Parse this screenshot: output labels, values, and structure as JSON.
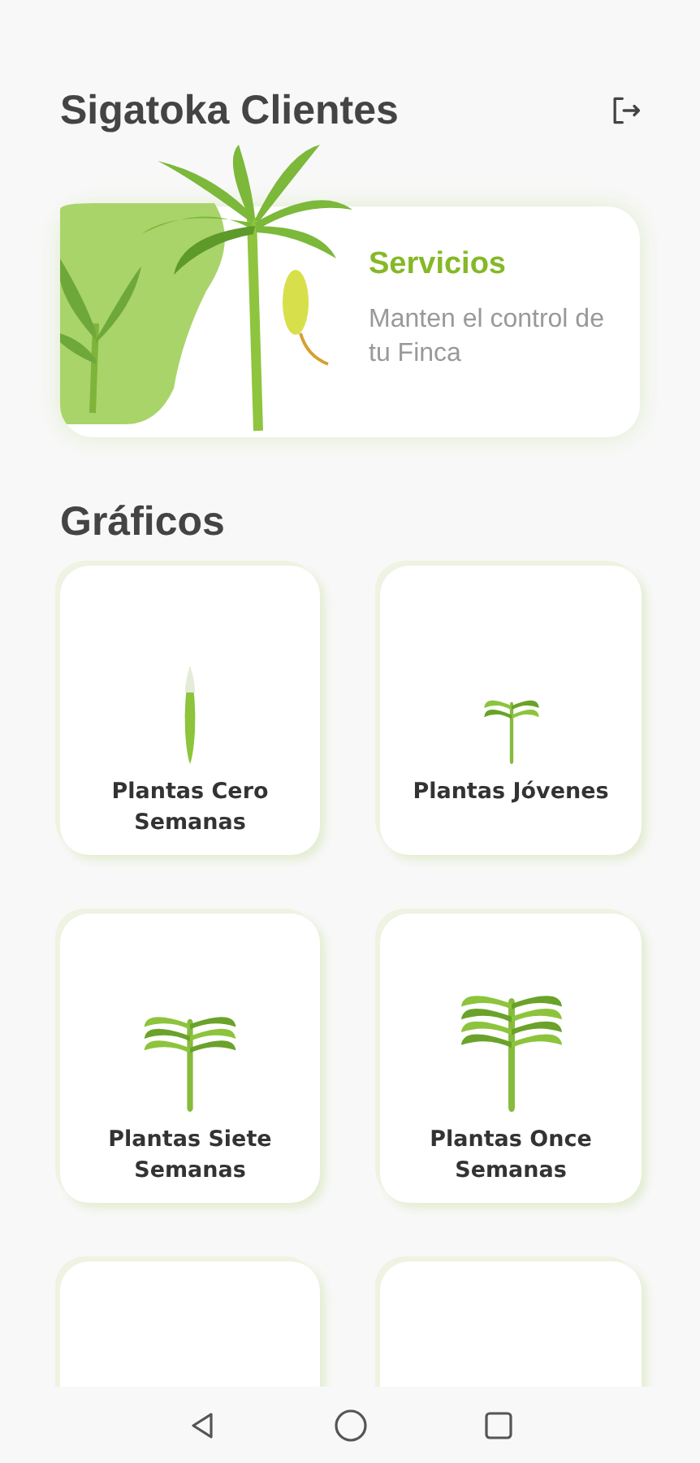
{
  "header": {
    "title": "Sigatoka Clientes"
  },
  "hero": {
    "title": "Servicios",
    "subtitle": "Manten el control de tu Finca"
  },
  "section": {
    "title": "Gráficos"
  },
  "cards": [
    {
      "kind": "sprout",
      "label": "Plantas Cero Semanas"
    },
    {
      "kind": "young",
      "label": "Plantas Jóvenes"
    },
    {
      "kind": "seven",
      "label": "Plantas Siete Semanas"
    },
    {
      "kind": "eleven",
      "label": "Plantas Once Semanas"
    },
    {
      "kind": "empty"
    },
    {
      "kind": "empty"
    }
  ]
}
